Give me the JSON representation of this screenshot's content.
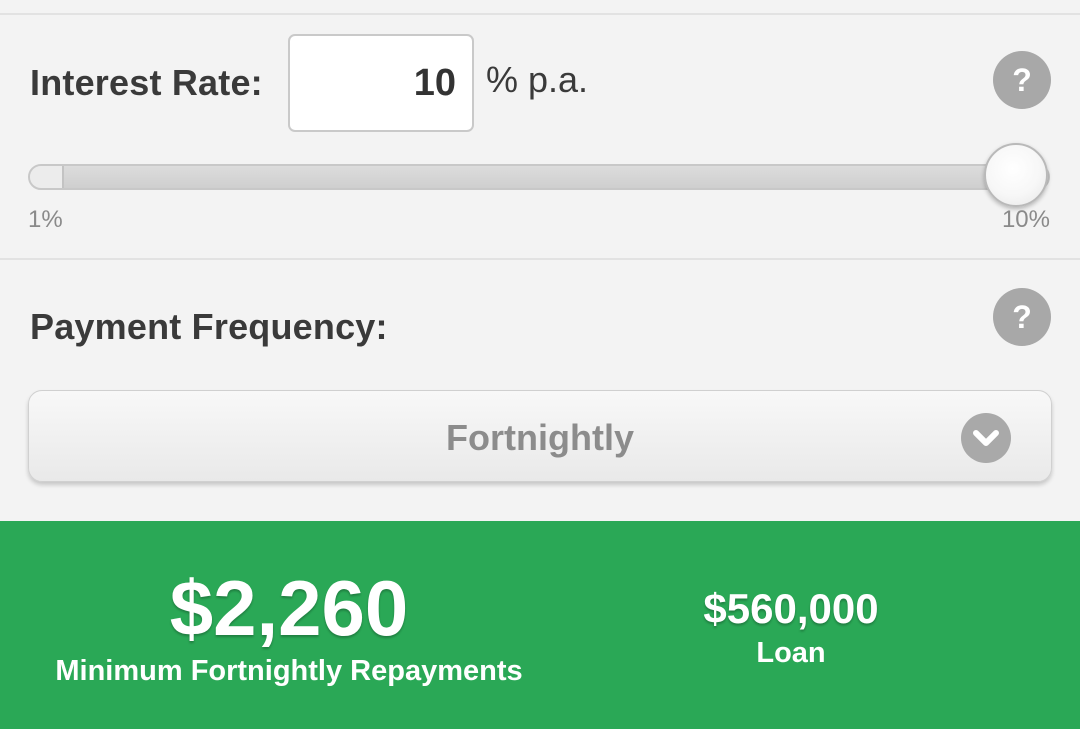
{
  "interest_rate": {
    "label": "Interest Rate:",
    "value": "10",
    "unit": "% p.a.",
    "help": "?",
    "slider": {
      "min_label": "1%",
      "max_label": "10%",
      "min": 1,
      "max": 10,
      "value": 10
    }
  },
  "payment_frequency": {
    "label": "Payment Frequency:",
    "help": "?",
    "selected": "Fortnightly",
    "dropdown_icon": "chevron-down-icon"
  },
  "results": {
    "amount": "$2,260",
    "amount_label": "Minimum Fortnightly Repayments",
    "loan_amount": "$560,000",
    "loan_label": "Loan",
    "background_color": "#2aa856"
  }
}
